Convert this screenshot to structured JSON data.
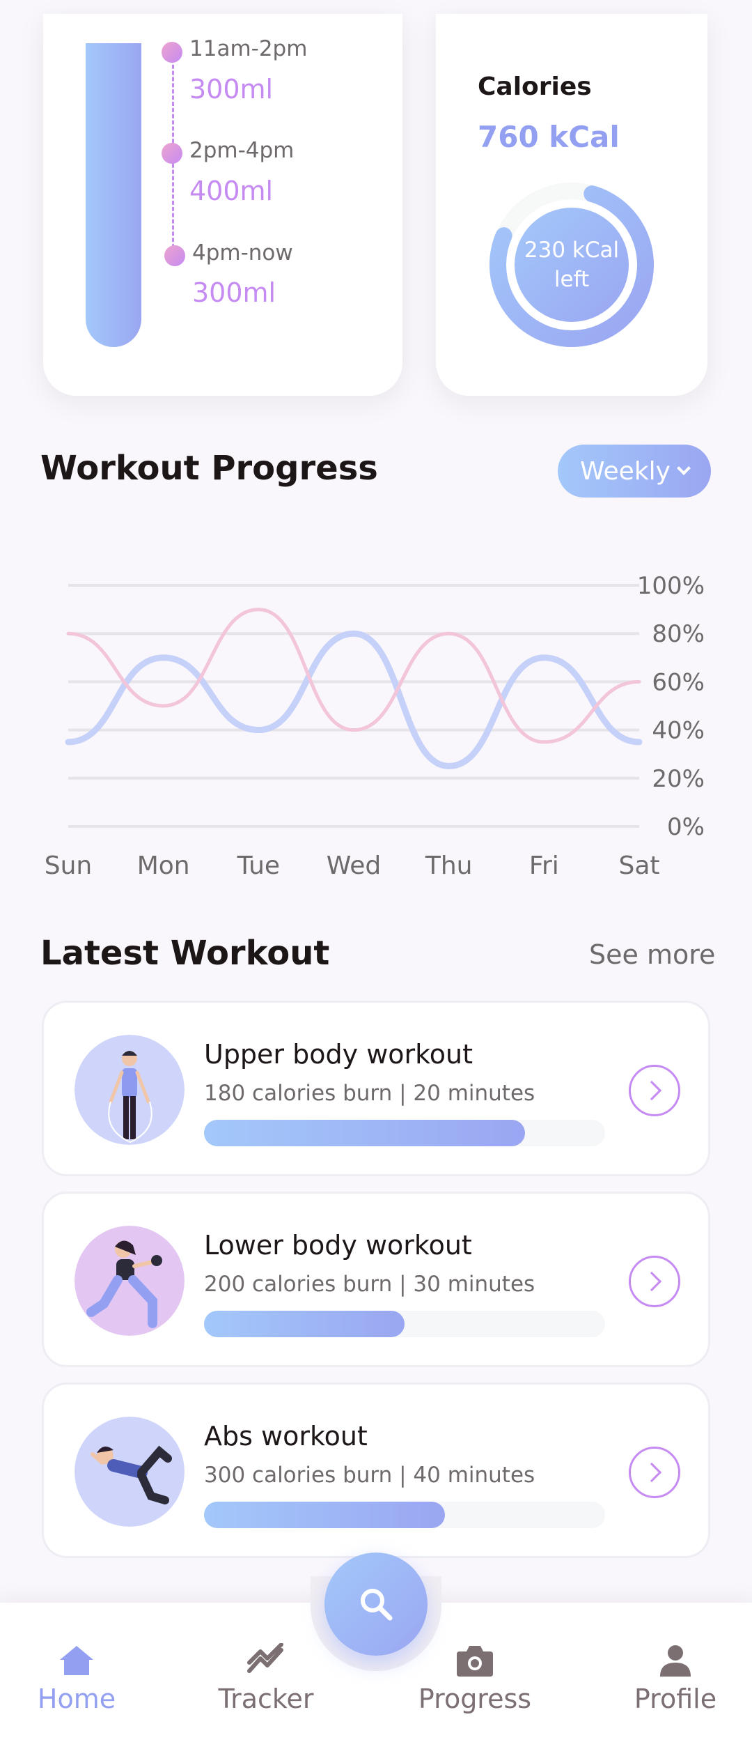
{
  "water": {
    "slots": [
      {
        "time": "11am-2pm",
        "amount": "300ml"
      },
      {
        "time": "2pm-4pm",
        "amount": "400ml"
      },
      {
        "time": "4pm-now",
        "amount": "300ml"
      }
    ]
  },
  "calories": {
    "title": "Calories",
    "value": "760 kCal",
    "remaining_line1": "230 kCal",
    "remaining_line2": "left",
    "consumed_fraction": 0.77
  },
  "workout_progress": {
    "title": "Workout Progress",
    "period_label": "Weekly"
  },
  "chart_data": {
    "type": "line",
    "categories": [
      "Sun",
      "Mon",
      "Tue",
      "Wed",
      "Thu",
      "Fri",
      "Sat"
    ],
    "y_ticks": [
      "0%",
      "20%",
      "40%",
      "60%",
      "80%",
      "100%"
    ],
    "ylim": [
      0,
      100
    ],
    "grid": true,
    "series": [
      {
        "color": "#C5D1F8",
        "values": [
          35,
          70,
          40,
          80,
          25,
          70,
          35
        ]
      },
      {
        "color": "#F2C5DA",
        "values": [
          80,
          50,
          90,
          40,
          80,
          35,
          60
        ]
      }
    ]
  },
  "latest_workout": {
    "title": "Latest Workout",
    "see_more": "See more",
    "items": [
      {
        "name": "Upper body workout",
        "meta": "180 calories burn | 20 minutes",
        "progress": 0.8
      },
      {
        "name": "Lower body workout",
        "meta": "200 calories burn | 30 minutes",
        "progress": 0.5
      },
      {
        "name": "Abs workout",
        "meta": "300 calories burn | 40 minutes",
        "progress": 0.6
      }
    ]
  },
  "nav": {
    "home": "Home",
    "tracker": "Tracker",
    "progress": "Progress",
    "profile": "Profile",
    "active_color": "#93A0F2"
  }
}
